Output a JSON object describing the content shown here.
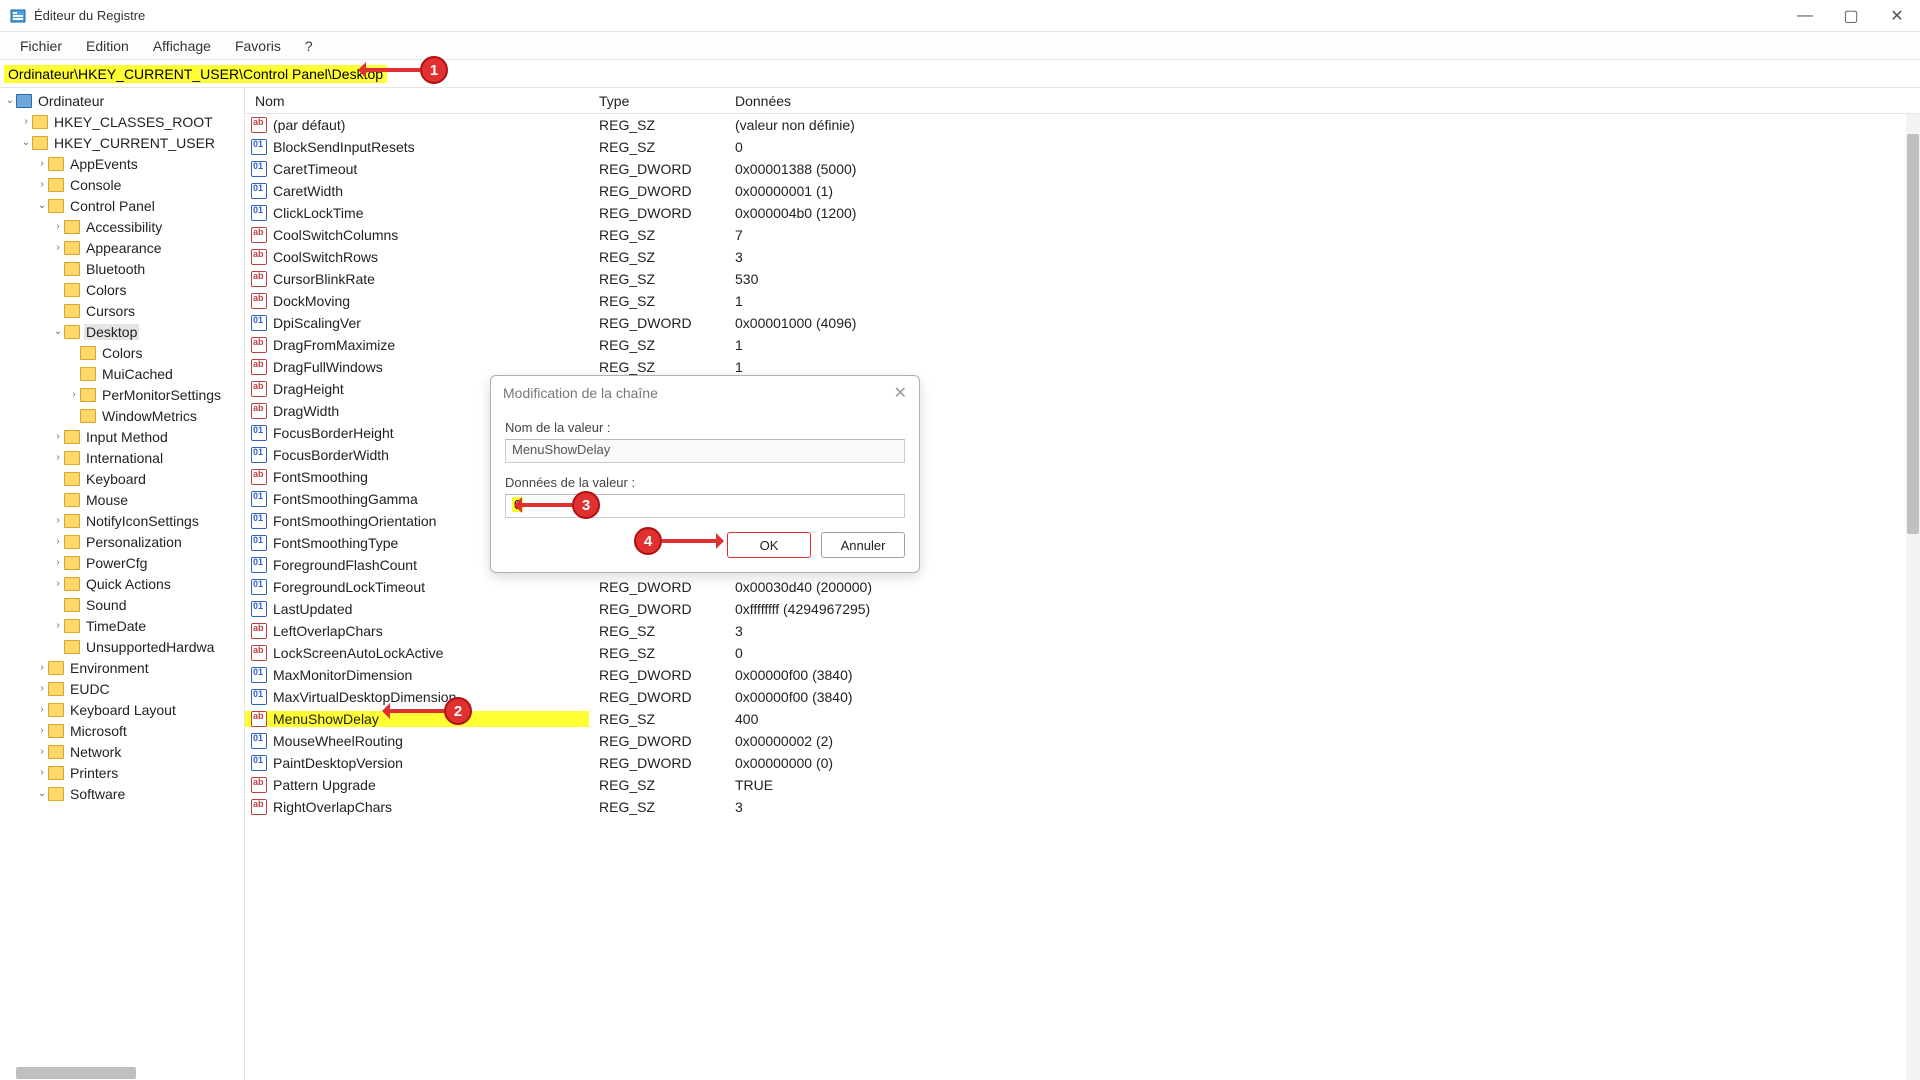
{
  "window": {
    "title": "Éditeur du Registre"
  },
  "menubar": [
    "Fichier",
    "Edition",
    "Affichage",
    "Favoris",
    "?"
  ],
  "address": "Ordinateur\\HKEY_CURRENT_USER\\Control Panel\\Desktop",
  "tree": [
    {
      "lvl": 0,
      "exp": "v",
      "icon": "comp",
      "label": "Ordinateur"
    },
    {
      "lvl": 1,
      "exp": ">",
      "label": "HKEY_CLASSES_ROOT"
    },
    {
      "lvl": 1,
      "exp": "v",
      "label": "HKEY_CURRENT_USER"
    },
    {
      "lvl": 2,
      "exp": ">",
      "label": "AppEvents"
    },
    {
      "lvl": 2,
      "exp": ">",
      "label": "Console"
    },
    {
      "lvl": 2,
      "exp": "v",
      "label": "Control Panel"
    },
    {
      "lvl": 3,
      "exp": ">",
      "label": "Accessibility"
    },
    {
      "lvl": 3,
      "exp": ">",
      "label": "Appearance"
    },
    {
      "lvl": 3,
      "exp": "",
      "label": "Bluetooth"
    },
    {
      "lvl": 3,
      "exp": "",
      "label": "Colors"
    },
    {
      "lvl": 3,
      "exp": "",
      "label": "Cursors"
    },
    {
      "lvl": 3,
      "exp": "v",
      "label": "Desktop",
      "sel": true
    },
    {
      "lvl": 4,
      "exp": "",
      "label": "Colors"
    },
    {
      "lvl": 4,
      "exp": "",
      "label": "MuiCached"
    },
    {
      "lvl": 4,
      "exp": ">",
      "label": "PerMonitorSettings"
    },
    {
      "lvl": 4,
      "exp": "",
      "label": "WindowMetrics"
    },
    {
      "lvl": 3,
      "exp": ">",
      "label": "Input Method"
    },
    {
      "lvl": 3,
      "exp": ">",
      "label": "International"
    },
    {
      "lvl": 3,
      "exp": "",
      "label": "Keyboard"
    },
    {
      "lvl": 3,
      "exp": "",
      "label": "Mouse"
    },
    {
      "lvl": 3,
      "exp": ">",
      "label": "NotifyIconSettings"
    },
    {
      "lvl": 3,
      "exp": ">",
      "label": "Personalization"
    },
    {
      "lvl": 3,
      "exp": ">",
      "label": "PowerCfg"
    },
    {
      "lvl": 3,
      "exp": ">",
      "label": "Quick Actions"
    },
    {
      "lvl": 3,
      "exp": "",
      "label": "Sound"
    },
    {
      "lvl": 3,
      "exp": ">",
      "label": "TimeDate"
    },
    {
      "lvl": 3,
      "exp": "",
      "label": "UnsupportedHardwa"
    },
    {
      "lvl": 2,
      "exp": ">",
      "label": "Environment"
    },
    {
      "lvl": 2,
      "exp": ">",
      "label": "EUDC"
    },
    {
      "lvl": 2,
      "exp": ">",
      "label": "Keyboard Layout"
    },
    {
      "lvl": 2,
      "exp": ">",
      "label": "Microsoft"
    },
    {
      "lvl": 2,
      "exp": ">",
      "label": "Network"
    },
    {
      "lvl": 2,
      "exp": ">",
      "label": "Printers"
    },
    {
      "lvl": 2,
      "exp": "v",
      "label": "Software"
    }
  ],
  "columns": {
    "name": "Nom",
    "type": "Type",
    "data": "Données"
  },
  "values": [
    {
      "k": "sz",
      "name": "(par défaut)",
      "type": "REG_SZ",
      "data": "(valeur non définie)"
    },
    {
      "k": "dw",
      "name": "BlockSendInputResets",
      "type": "REG_SZ",
      "data": "0"
    },
    {
      "k": "dw",
      "name": "CaretTimeout",
      "type": "REG_DWORD",
      "data": "0x00001388 (5000)"
    },
    {
      "k": "dw",
      "name": "CaretWidth",
      "type": "REG_DWORD",
      "data": "0x00000001 (1)"
    },
    {
      "k": "dw",
      "name": "ClickLockTime",
      "type": "REG_DWORD",
      "data": "0x000004b0 (1200)"
    },
    {
      "k": "sz",
      "name": "CoolSwitchColumns",
      "type": "REG_SZ",
      "data": "7"
    },
    {
      "k": "sz",
      "name": "CoolSwitchRows",
      "type": "REG_SZ",
      "data": "3"
    },
    {
      "k": "sz",
      "name": "CursorBlinkRate",
      "type": "REG_SZ",
      "data": "530"
    },
    {
      "k": "sz",
      "name": "DockMoving",
      "type": "REG_SZ",
      "data": "1"
    },
    {
      "k": "dw",
      "name": "DpiScalingVer",
      "type": "REG_DWORD",
      "data": "0x00001000 (4096)"
    },
    {
      "k": "sz",
      "name": "DragFromMaximize",
      "type": "REG_SZ",
      "data": "1"
    },
    {
      "k": "sz",
      "name": "DragFullWindows",
      "type": "REG_SZ",
      "data": "1"
    },
    {
      "k": "sz",
      "name": "DragHeight",
      "type": "",
      "data": ""
    },
    {
      "k": "sz",
      "name": "DragWidth",
      "type": "",
      "data": ""
    },
    {
      "k": "dw",
      "name": "FocusBorderHeight",
      "type": "",
      "data": ""
    },
    {
      "k": "dw",
      "name": "FocusBorderWidth",
      "type": "",
      "data": ""
    },
    {
      "k": "sz",
      "name": "FontSmoothing",
      "type": "",
      "data": ""
    },
    {
      "k": "dw",
      "name": "FontSmoothingGamma",
      "type": "",
      "data": ""
    },
    {
      "k": "dw",
      "name": "FontSmoothingOrientation",
      "type": "",
      "data": ""
    },
    {
      "k": "dw",
      "name": "FontSmoothingType",
      "type": "",
      "data": ""
    },
    {
      "k": "dw",
      "name": "ForegroundFlashCount",
      "type": "",
      "data": ""
    },
    {
      "k": "dw",
      "name": "ForegroundLockTimeout",
      "type": "REG_DWORD",
      "data": "0x00030d40 (200000)"
    },
    {
      "k": "dw",
      "name": "LastUpdated",
      "type": "REG_DWORD",
      "data": "0xffffffff (4294967295)"
    },
    {
      "k": "sz",
      "name": "LeftOverlapChars",
      "type": "REG_SZ",
      "data": "3"
    },
    {
      "k": "sz",
      "name": "LockScreenAutoLockActive",
      "type": "REG_SZ",
      "data": "0"
    },
    {
      "k": "dw",
      "name": "MaxMonitorDimension",
      "type": "REG_DWORD",
      "data": "0x00000f00 (3840)"
    },
    {
      "k": "dw",
      "name": "MaxVirtualDesktopDimension",
      "type": "REG_DWORD",
      "data": "0x00000f00 (3840)"
    },
    {
      "k": "sz",
      "name": "MenuShowDelay",
      "type": "REG_SZ",
      "data": "400",
      "hl": true
    },
    {
      "k": "dw",
      "name": "MouseWheelRouting",
      "type": "REG_DWORD",
      "data": "0x00000002 (2)"
    },
    {
      "k": "dw",
      "name": "PaintDesktopVersion",
      "type": "REG_DWORD",
      "data": "0x00000000 (0)"
    },
    {
      "k": "sz",
      "name": "Pattern Upgrade",
      "type": "REG_SZ",
      "data": "TRUE"
    },
    {
      "k": "sz",
      "name": "RightOverlapChars",
      "type": "REG_SZ",
      "data": "3"
    }
  ],
  "dialog": {
    "title": "Modification de la chaîne",
    "label_name": "Nom de la valeur :",
    "value_name": "MenuShowDelay",
    "label_data": "Données de la valeur :",
    "value_data": "0",
    "ok": "OK",
    "cancel": "Annuler"
  },
  "callouts": {
    "c1": "1",
    "c2": "2",
    "c3": "3",
    "c4": "4"
  }
}
